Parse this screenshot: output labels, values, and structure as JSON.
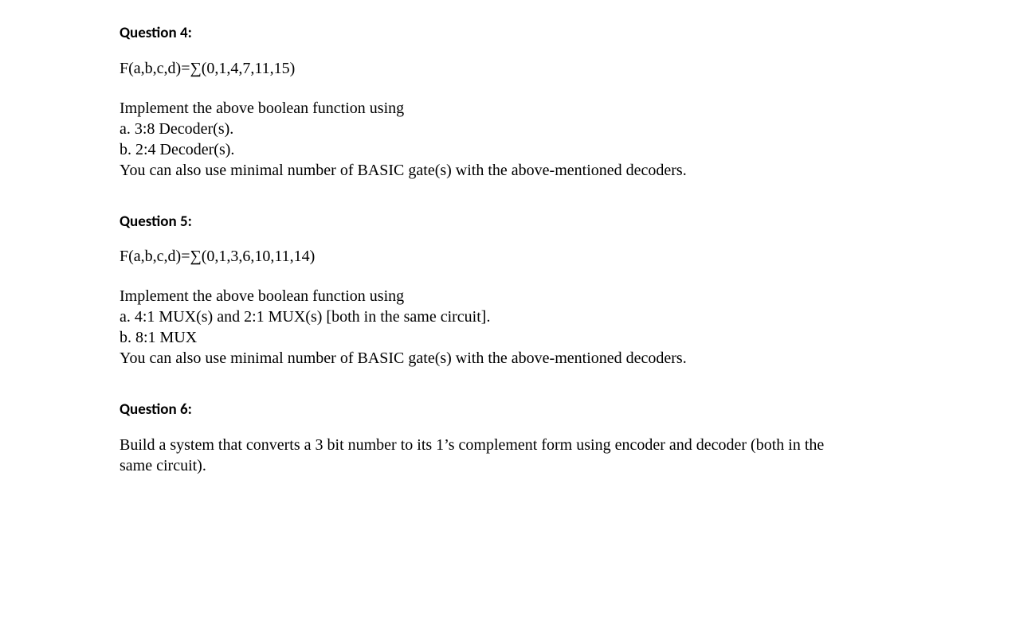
{
  "questions": [
    {
      "heading": "Question 4:",
      "equation": "F(a,b,c,d)=∑(0,1,4,7,11,15)",
      "intro": "Implement the above boolean function using",
      "parts": [
        "a. 3:8 Decoder(s).",
        "b. 2:4 Decoder(s)."
      ],
      "note": "You can also use minimal number of BASIC gate(s) with the above-mentioned decoders."
    },
    {
      "heading": "Question 5:",
      "equation": "F(a,b,c,d)=∑(0,1,3,6,10,11,14)",
      "intro": "Implement the above boolean function using",
      "parts": [
        "a. 4:1 MUX(s) and 2:1 MUX(s) [both in the same circuit].",
        "b. 8:1 MUX"
      ],
      "note": "You can also use minimal number of BASIC gate(s) with the above-mentioned decoders."
    },
    {
      "heading": "Question 6:",
      "equation": "",
      "intro": "",
      "parts": [],
      "note": "Build a system that converts a 3 bit number to its 1’s complement form using encoder and decoder (both in the same circuit)."
    }
  ]
}
